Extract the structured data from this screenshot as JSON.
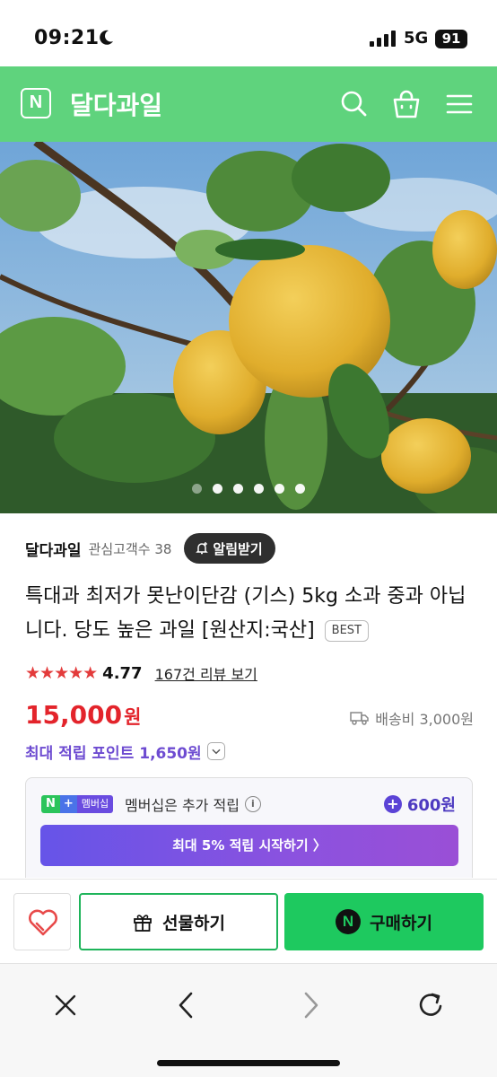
{
  "status_bar": {
    "time": "09:21",
    "network": "5G",
    "battery": "91"
  },
  "header": {
    "logo": "N",
    "store_name": "달다과일"
  },
  "hero": {
    "image_count": 6,
    "active_index": 0
  },
  "seller": {
    "name": "달다과일",
    "follower_label": "관심고객수 38",
    "alarm_label": "알림받기"
  },
  "product": {
    "title": "특대과 최저가 못난이단감 (기스) 5kg 소과 중과 아닙니다. 당도 높은 과일 [원산지:국산]",
    "badge": "BEST",
    "rating": "4.77",
    "stars": "★★★★★",
    "review_link": "167건 리뷰 보기",
    "price": "15,000",
    "price_unit": "원",
    "shipping": "배송비 3,000원",
    "points": "최대 적립 포인트 1,650원"
  },
  "membership": {
    "badge_n": "N",
    "badge_plus": "+",
    "badge_label": "멤버십",
    "text": "멤버십은 추가 적립",
    "info": "i",
    "bonus": "600원",
    "cta": "최대 5% 적립 시작하기 〉"
  },
  "purchase": {
    "gift_label": "선물하기",
    "buy_label": "구매하기",
    "npay_logo": "N"
  },
  "colors": {
    "brand_green": "#5fd37d",
    "price_red": "#e3242b",
    "points_purple": "#6d4bd1",
    "buy_green": "#1ec95f"
  }
}
